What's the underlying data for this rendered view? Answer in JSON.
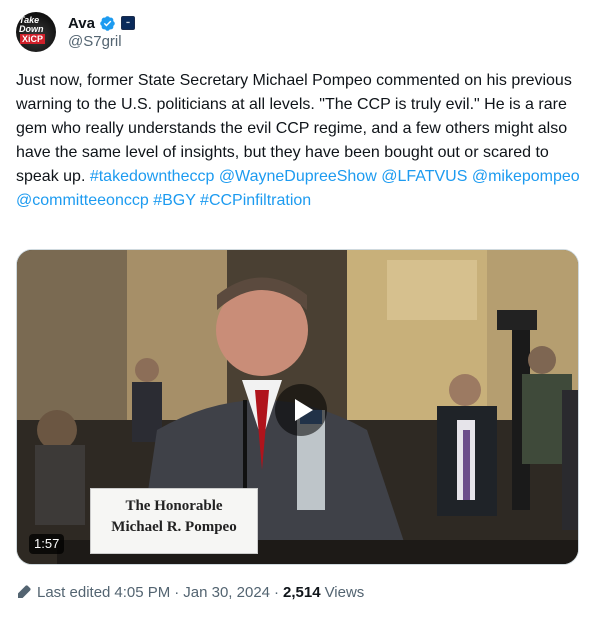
{
  "author": {
    "display_name": "Ava",
    "handle": "@S7gril",
    "avatar_text": [
      "Take",
      "Down",
      "XiCP"
    ]
  },
  "tweet": {
    "text_parts": [
      "Just now, former State Secretary Michael Pompeo commented on his previous warning to the U.S. politicians at all levels. \"The CCP is truly evil.\" He is a rare gem who really understands the evil CCP regime, and a few others might also have the same level of insights, but they have been bought out or scared to speak up. "
    ],
    "links": [
      "#takedowntheccp",
      "@WayneDupreeShow",
      "@LFATVUS",
      "@mikepompeo",
      "@committeeonccp",
      "#BGY",
      "#CCPinfiltration"
    ]
  },
  "media": {
    "duration": "1:57",
    "nameplate_line1": "The Honorable",
    "nameplate_line2": "Michael R. Pompeo"
  },
  "footer": {
    "edited_label": "Last edited",
    "time": "4:05 PM",
    "date": "Jan 30, 2024",
    "views_count": "2,514",
    "views_label": "Views"
  },
  "colors": {
    "link": "#1d9bf0",
    "secondary_text": "#536471",
    "verified": "#1d9bf0"
  }
}
